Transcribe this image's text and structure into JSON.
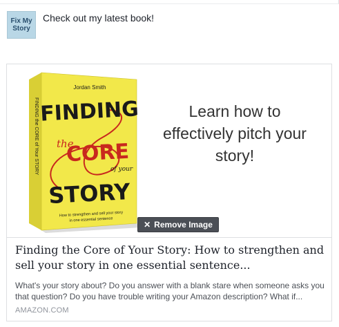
{
  "post": {
    "avatar_text": "Fix My Story",
    "status_text": "Check out my latest book!"
  },
  "link_card": {
    "book_cover": {
      "author": "Jordan Smith",
      "title_line1": "FINDING",
      "title_the": "the",
      "title_core": "CORE",
      "title_of_your": "of your",
      "title_story": "STORY",
      "subtitle_line1": "How to strengthen and sell your story",
      "subtitle_line2": "in one essential sentence",
      "spine_text": "FINDING the CORE of Your STORY",
      "colors": {
        "cover": "#f2e84a",
        "spine": "#d9cf35",
        "title_red": "#c8281e",
        "ink": "#1a1a1a"
      }
    },
    "image_tagline": "Learn how to effectively pitch your story!",
    "remove_image_label": "Remove Image",
    "title": "Finding the Core of Your Story: How to strengthen and sell your story in one essential sentence...",
    "description": "What's your story about? Do you answer with a blank stare when someone asks you that question? Do you have trouble writing your Amazon description? What if...",
    "domain": "AMAZON.COM"
  }
}
